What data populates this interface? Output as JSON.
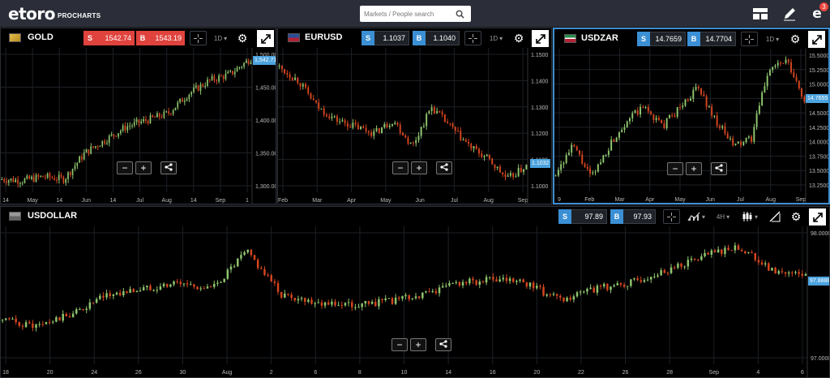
{
  "topbar": {
    "brand": "etoro",
    "brand_sub": "PROCHARTS",
    "search_placeholder": "Markets / People search",
    "notifications_count": "3",
    "icons": [
      "layout-icon",
      "pencil-icon",
      "profile-icon"
    ]
  },
  "colors": {
    "up": "#8ec56e",
    "down": "#d4451f",
    "accent": "#4ba3df",
    "sell_gold": "#e0433d",
    "buy_blue": "#3b8fd4"
  },
  "panels": {
    "gold": {
      "title": "GOLD",
      "sell_label": "S",
      "buy_label": "B",
      "sell": "1542.74",
      "buy": "1543.19",
      "timeframe": "1D",
      "price_tag": "1,542.71",
      "yticks": [
        "1,500.00",
        "1,450.00",
        "1,400.00",
        "1,350.00",
        "1,300.00"
      ],
      "xticks": [
        "14",
        "May",
        "14",
        "Jun",
        "14",
        "Jul",
        "Aug",
        "14",
        "Sep",
        "1"
      ]
    },
    "eurusd": {
      "title": "EURUSD",
      "sell_label": "S",
      "buy_label": "B",
      "sell": "1.1037",
      "buy": "1.1040",
      "timeframe": "1D",
      "price_tag": "1.1032",
      "yticks": [
        "1.1500",
        "1.1400",
        "1.1300",
        "1.1200",
        "1.1100",
        "1.1000"
      ],
      "xticks": [
        "Feb",
        "Mar",
        "Apr",
        "May",
        "Jun",
        "Jul",
        "Aug",
        "Sep"
      ]
    },
    "usdzar": {
      "title": "USDZAR",
      "sell_label": "S",
      "buy_label": "B",
      "sell": "14.7659",
      "buy": "14.7704",
      "timeframe": "1D",
      "price_tag": "14.7655",
      "yticks": [
        "15.5000",
        "15.2500",
        "15.0000",
        "14.7500",
        "14.5000",
        "14.2500",
        "14.0000",
        "13.7500",
        "13.5000",
        "13.2500"
      ],
      "xticks": [
        "9",
        "Feb",
        "Mar",
        "Apr",
        "May",
        "Jun",
        "Jul",
        "Aug",
        "Sep"
      ]
    },
    "usdollar": {
      "title": "USDOLLAR",
      "sell_label": "S",
      "buy_label": "B",
      "sell": "97.89",
      "buy": "97.93",
      "timeframe": "4H",
      "price_tag": "97.8888",
      "yticks": [
        "98.0000",
        "97.0000"
      ],
      "xticks": [
        "18",
        "20",
        "24",
        "26",
        "30",
        "Aug",
        "2",
        "6",
        "8",
        "10",
        "14",
        "16",
        "20",
        "22",
        "26",
        "28",
        "Sep",
        "4",
        "6"
      ]
    }
  },
  "zoom": {
    "minus": "−",
    "plus": "+"
  }
}
